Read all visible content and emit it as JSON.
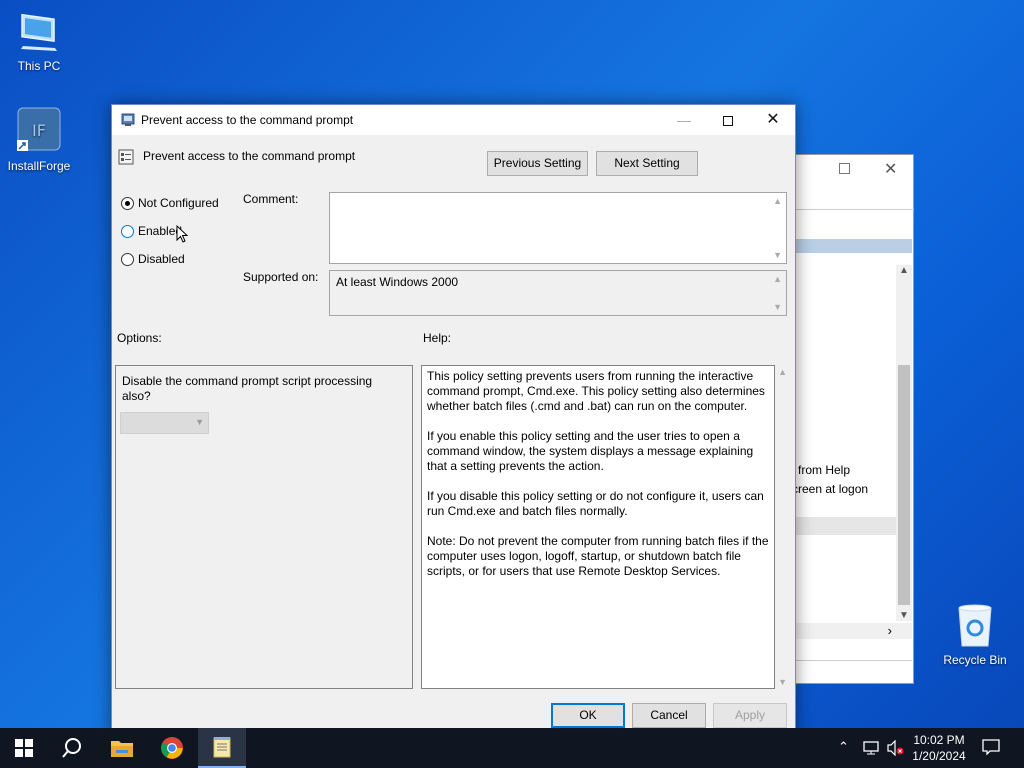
{
  "desktop": {
    "icons": [
      {
        "label": "This PC"
      },
      {
        "label": "InstallForge"
      },
      {
        "label": "Recycle Bin"
      }
    ]
  },
  "background_window": {
    "text_line1": "from Help",
    "text_line2": "creen at logon"
  },
  "dialog": {
    "title": "Prevent access to the command prompt",
    "policy_name": "Prevent access to the command prompt",
    "buttons": {
      "previous": "Previous Setting",
      "next": "Next Setting",
      "ok": "OK",
      "cancel": "Cancel",
      "apply": "Apply"
    },
    "state": {
      "options": [
        "Not Configured",
        "Enabled",
        "Disabled"
      ],
      "selected": "Not Configured"
    },
    "comment": {
      "label": "Comment:",
      "value": ""
    },
    "supported": {
      "label": "Supported on:",
      "value": "At least Windows 2000"
    },
    "options_label": "Options:",
    "help_label": "Help:",
    "option_question": "Disable the command prompt script processing also?",
    "option_dropdown_value": "",
    "help_paragraphs": [
      "This policy setting prevents users from running the interactive command prompt, Cmd.exe.  This policy setting also determines whether batch files (.cmd and .bat) can run on the computer.",
      "If you enable this policy setting and the user tries to open a command window, the system displays a message explaining that a setting prevents the action.",
      "If you disable this policy setting or do not configure it, users can run Cmd.exe and batch files normally.",
      "Note: Do not prevent the computer from running batch files if the computer uses logon, logoff, startup, or shutdown batch file scripts, or for users that use Remote Desktop Services."
    ]
  },
  "taskbar": {
    "time": "10:02 PM",
    "date": "1/20/2024"
  },
  "colors": {
    "accent": "#0078d7",
    "taskbar": "#101522",
    "desktop": "#1575e0"
  }
}
